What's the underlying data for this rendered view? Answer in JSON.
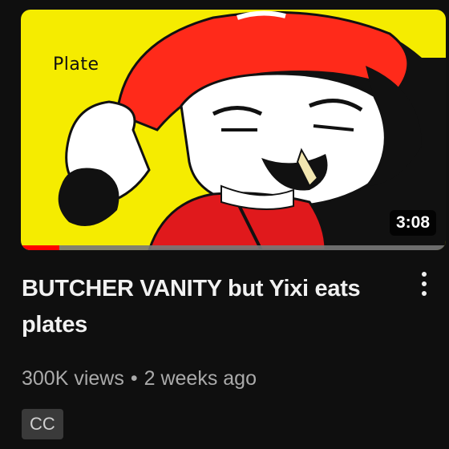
{
  "thumbnail": {
    "overlay_text": "Plate",
    "duration": "3:08",
    "watched_fraction": 0.09,
    "colors": {
      "background": "#f5ec00",
      "cap": "#ff2a1a",
      "progress": "#ff0000"
    }
  },
  "video": {
    "title": "BUTCHER VANITY but Yixi eats plates",
    "views": "300K views",
    "separator": "•",
    "age": "2 weeks ago",
    "badge": "CC"
  },
  "menu": {
    "icon": "more-vert-icon"
  }
}
